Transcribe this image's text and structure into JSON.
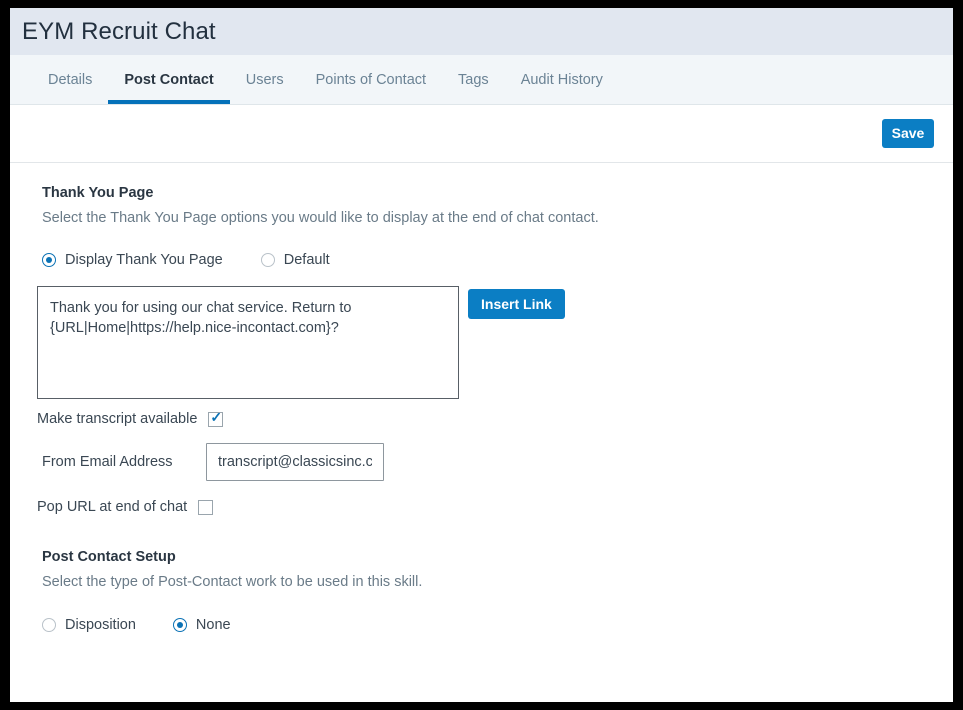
{
  "window": {
    "title": "EYM Recruit Chat"
  },
  "tabs": [
    {
      "label": "Details",
      "active": false
    },
    {
      "label": "Post Contact",
      "active": true
    },
    {
      "label": "Users",
      "active": false
    },
    {
      "label": "Points of Contact",
      "active": false
    },
    {
      "label": "Tags",
      "active": false
    },
    {
      "label": "Audit History",
      "active": false
    }
  ],
  "toolbar": {
    "save_label": "Save"
  },
  "thank_you_section": {
    "title": "Thank You Page",
    "description": "Select the Thank You Page options you would like to display at the end of chat contact.",
    "options": [
      {
        "label": "Display Thank You Page",
        "selected": true
      },
      {
        "label": "Default",
        "selected": false
      }
    ],
    "message": "Thank you for using our chat service. Return to {URL|Home|https://help.nice-incontact.com}?",
    "insert_link_label": "Insert Link",
    "make_transcript_label": "Make transcript available",
    "make_transcript_checked": true,
    "from_email_label": "From Email Address",
    "from_email_value": "transcript@classicsinc.com",
    "pop_url_label": "Pop URL at end of chat",
    "pop_url_checked": false
  },
  "post_contact_section": {
    "title": "Post Contact Setup",
    "description": "Select the type of Post-Contact work to be used in this skill.",
    "options": [
      {
        "label": "Disposition",
        "selected": false
      },
      {
        "label": "None",
        "selected": true
      }
    ]
  },
  "colors": {
    "accent_blue": "#0b7ec4",
    "tab_underline": "#0571b9",
    "title_bar_bg": "#e1e7f0",
    "tab_bar_bg": "#f2f6f9",
    "radio_selected": "#0b72b5"
  }
}
